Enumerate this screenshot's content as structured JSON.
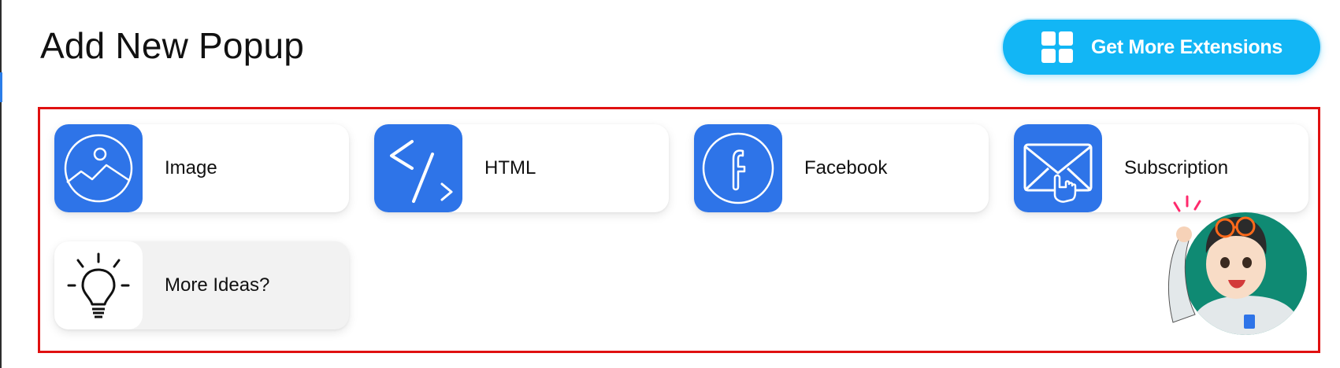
{
  "page": {
    "title": "Add New Popup"
  },
  "header": {
    "extensions_button": {
      "label": "Get More Extensions",
      "icon": "grid-icon",
      "color": "#12b6f5"
    }
  },
  "colors": {
    "card_icon_bg": "#2e74e8",
    "frame_border": "#e01010",
    "accent": "#12b6f5"
  },
  "popup_types": [
    {
      "label": "Image",
      "icon": "image-icon"
    },
    {
      "label": "HTML",
      "icon": "code-icon"
    },
    {
      "label": "Facebook",
      "icon": "facebook-icon"
    },
    {
      "label": "Subscription",
      "icon": "mail-click-icon"
    },
    {
      "label": "More Ideas?",
      "icon": "lightbulb-icon"
    }
  ],
  "mascot": {
    "icon": "support-mascot-avatar"
  }
}
